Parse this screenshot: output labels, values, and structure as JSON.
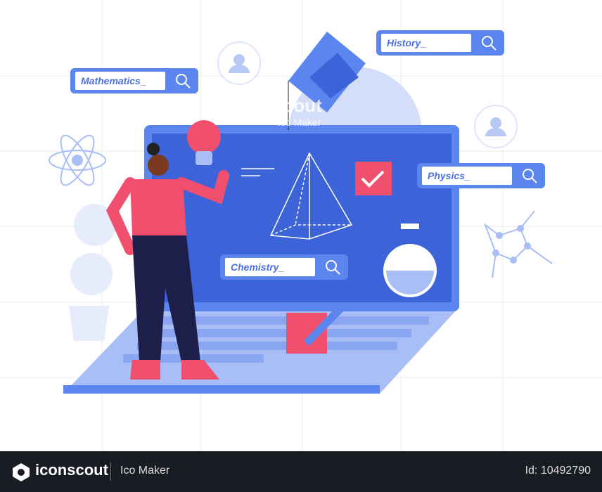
{
  "search_bars": {
    "mathematics": "Mathematics_",
    "history": "History_",
    "physics": "Physics_",
    "chemistry": "Chemistry_"
  },
  "watermark": {
    "brand": "iconscout",
    "sub": "Ico Maker"
  },
  "footer": {
    "brand": "iconscout",
    "author": "Ico Maker",
    "id": "Id: 10492790"
  },
  "colors": {
    "primary": "#5b85ef",
    "screen": "#3c63d8",
    "accent": "#f0506e",
    "footer": "#1a1c23"
  }
}
